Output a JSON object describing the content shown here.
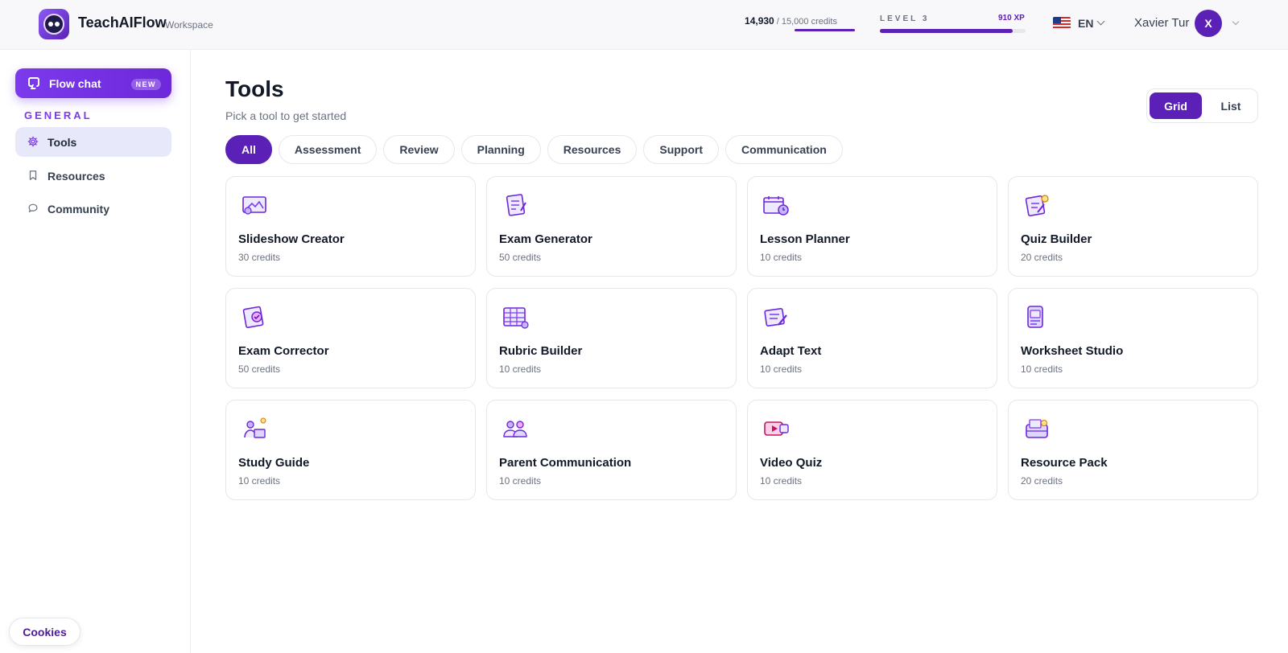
{
  "header": {
    "brand": "TeachAIFlow",
    "brand_sub": "Workspace",
    "credits_used": "14,930",
    "credits_total": "/ 15,000 credits",
    "credits_fraction": 0.995,
    "level_label": "LEVEL 3",
    "xp_label": "910 XP",
    "xp_fraction": 0.91,
    "language": "EN",
    "flag_icon": "us-flag-icon",
    "user_name": "Xavier Tur",
    "avatar_initial": "X"
  },
  "sidebar": {
    "flow_chat_label": "Flow chat",
    "flow_chat_badge": "NEW",
    "section_label": "GENERAL",
    "items": [
      {
        "label": "Tools",
        "icon": "gear-icon",
        "active": true
      },
      {
        "label": "Resources",
        "icon": "bookmark-icon",
        "active": false
      },
      {
        "label": "Community",
        "icon": "chat-bubble-icon",
        "active": false
      }
    ],
    "cookies_label": "Cookies"
  },
  "main": {
    "title": "Tools",
    "subtitle": "Pick a tool to get started",
    "view_grid_label": "Grid",
    "view_list_label": "List",
    "filters": [
      "All",
      "Assessment",
      "Review",
      "Planning",
      "Resources",
      "Support",
      "Communication"
    ],
    "active_filter": "All",
    "tools": [
      {
        "name": "Slideshow Creator",
        "credits": "30 credits",
        "icon": "slideshow-icon"
      },
      {
        "name": "Exam Generator",
        "credits": "50 credits",
        "icon": "exam-icon"
      },
      {
        "name": "Lesson Planner",
        "credits": "10 credits",
        "icon": "calendar-clock-icon"
      },
      {
        "name": "Quiz Builder",
        "credits": "20 credits",
        "icon": "quiz-icon"
      },
      {
        "name": "Exam Corrector",
        "credits": "50 credits",
        "icon": "exam-check-icon"
      },
      {
        "name": "Rubric Builder",
        "credits": "10 credits",
        "icon": "rubric-grid-icon"
      },
      {
        "name": "Adapt Text",
        "credits": "10 credits",
        "icon": "notepad-pencil-icon"
      },
      {
        "name": "Worksheet Studio",
        "credits": "10 credits",
        "icon": "worksheet-stack-icon"
      },
      {
        "name": "Study Guide",
        "credits": "10 credits",
        "icon": "study-guide-icon"
      },
      {
        "name": "Parent Communication",
        "credits": "10 credits",
        "icon": "people-group-icon"
      },
      {
        "name": "Video Quiz",
        "credits": "10 credits",
        "icon": "video-play-icon"
      },
      {
        "name": "Resource Pack",
        "credits": "20 credits",
        "icon": "resource-pack-icon"
      }
    ]
  },
  "colors": {
    "accent": "#5b21b6",
    "accent_light": "#7c3aed",
    "active_nav_bg": "#e8e8fb"
  }
}
